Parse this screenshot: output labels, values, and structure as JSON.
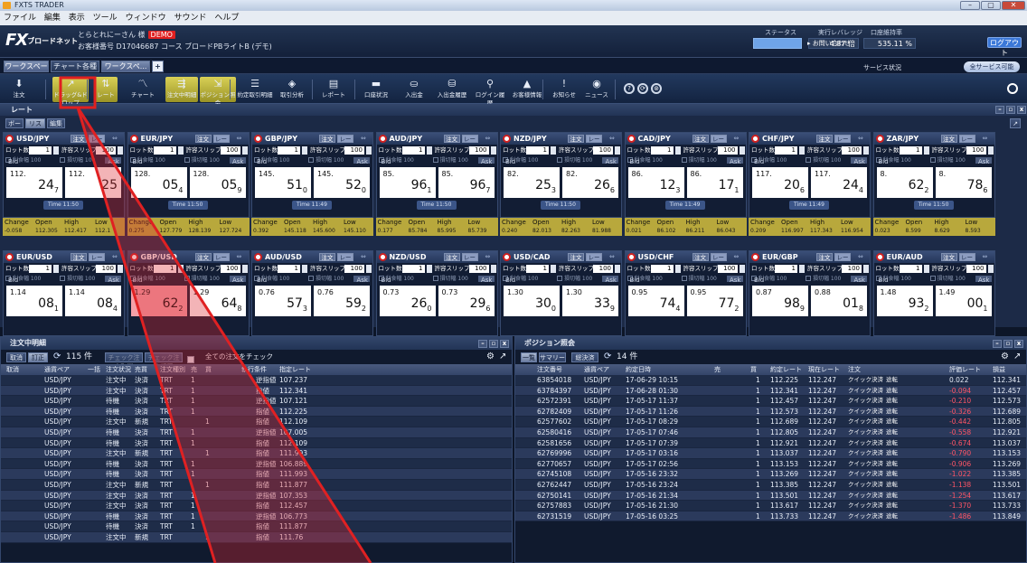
{
  "window": {
    "title": "FXTS TRADER",
    "buttons": [
      "–",
      "▢",
      "✕"
    ]
  },
  "menu": [
    "ファイル",
    "編集",
    "表示",
    "ツール",
    "ウィンドウ",
    "サウンド",
    "ヘルプ"
  ],
  "header": {
    "logo": "FX",
    "logo_sub": "ブロードネット",
    "user_name": "とらとれにーさん 様",
    "demo_badge": "DEMO",
    "account_line": "お客様番号 D17046687  コース ブロードPBライトB (デモ)",
    "status_label": "ステータス",
    "leverage_label": "実行レバレッジ",
    "leverage_value": "4.87 倍",
    "margin_label": "口座維持率",
    "margin_value": "535.11 %",
    "contact_label": "▸ お問い合わせ",
    "logout_label": "ログアウト"
  },
  "workspace": {
    "tabs": [
      {
        "label": "ワークスペース",
        "active": true
      },
      {
        "label": "チャート各種",
        "active": false
      },
      {
        "label": "ワークスペ... ▾",
        "active": true
      }
    ],
    "add_label": "+",
    "service_status_label": "サービス状況",
    "service_badge": "全サービス可能"
  },
  "toolbar": {
    "buttons": [
      {
        "label": "注文",
        "icon": "arrow-down-icon",
        "glyph": "⬇"
      },
      {
        "label": "ドラッグ&ドロップ",
        "icon": "drag-icon",
        "glyph": "↗"
      },
      {
        "label": "レート",
        "icon": "rate-icon",
        "glyph": "⇅"
      },
      {
        "label": "チャート",
        "icon": "chart-icon",
        "glyph": "〽"
      },
      {
        "label": "注文中明細",
        "icon": "order-list-icon",
        "glyph": "⇶"
      },
      {
        "label": "ポジション照会",
        "icon": "position-icon",
        "glyph": "⇲"
      },
      {
        "label": "約定取引明細",
        "icon": "trade-detail-icon",
        "glyph": "☰"
      },
      {
        "label": "取引分析",
        "icon": "analysis-icon",
        "glyph": "◈"
      },
      {
        "label": "レポート",
        "icon": "report-icon",
        "glyph": "▤"
      },
      {
        "label": "口座状況",
        "icon": "account-icon",
        "glyph": "▬"
      },
      {
        "label": "入出金",
        "icon": "deposit-icon",
        "glyph": "⛀"
      },
      {
        "label": "入出金履歴",
        "icon": "history-icon",
        "glyph": "⛁"
      },
      {
        "label": "ログイン履歴",
        "icon": "login-icon",
        "glyph": "⚲"
      },
      {
        "label": "お客様情報",
        "icon": "user-icon",
        "glyph": "▲"
      },
      {
        "label": "お知らせ",
        "icon": "notice-icon",
        "glyph": "!"
      },
      {
        "label": "ニュース",
        "icon": "news-icon",
        "glyph": "◉"
      }
    ],
    "circle_buttons": [
      "?",
      "⟳",
      "⊚"
    ]
  },
  "rate_panel": {
    "title": "レート",
    "view_buttons": [
      "ボード",
      "リスト",
      "編集"
    ],
    "lot_label": "ロット数",
    "slip_label": "許容スリップ",
    "profit_label": "利食幅",
    "loss_label": "損切幅",
    "order_label": "注文",
    "rate_label": "レート",
    "bid_label": "Bid",
    "ask_label": "Ask",
    "change_headers": [
      "Change",
      "Open",
      "High",
      "Low"
    ],
    "pairs_row1": [
      {
        "pair": "USD/JPY",
        "bid_head": "112.",
        "bid_tail": "24",
        "bid_sub": "7",
        "ask_head": "112.",
        "ask_tail": "25",
        "ask_sub": "",
        "time": "Time 11:50",
        "change": "-0.058",
        "open": "112.305",
        "high": "112.417",
        "low": "112.1"
      },
      {
        "pair": "EUR/JPY",
        "bid_head": "128.",
        "bid_tail": "05",
        "bid_sub": "4",
        "ask_head": "128.",
        "ask_tail": "05",
        "ask_sub": "9",
        "time": "Time 11:50",
        "change": "0.275",
        "open": "127.779",
        "high": "128.139",
        "low": "127.724"
      },
      {
        "pair": "GBP/JPY",
        "bid_head": "145.",
        "bid_tail": "51",
        "bid_sub": "0",
        "ask_head": "145.",
        "ask_tail": "52",
        "ask_sub": "0",
        "time": "Time 11:49",
        "change": "0.392",
        "open": "145.118",
        "high": "145.600",
        "low": "145.110"
      },
      {
        "pair": "AUD/JPY",
        "bid_head": "85.",
        "bid_tail": "96",
        "bid_sub": "1",
        "ask_head": "85.",
        "ask_tail": "96",
        "ask_sub": "7",
        "time": "Time 11:50",
        "change": "0.177",
        "open": "85.784",
        "high": "85.995",
        "low": "85.739"
      },
      {
        "pair": "NZD/JPY",
        "bid_head": "82.",
        "bid_tail": "25",
        "bid_sub": "3",
        "ask_head": "82.",
        "ask_tail": "26",
        "ask_sub": "6",
        "time": "Time 11:50",
        "change": "0.240",
        "open": "82.013",
        "high": "82.263",
        "low": "81.988"
      },
      {
        "pair": "CAD/JPY",
        "bid_head": "86.",
        "bid_tail": "12",
        "bid_sub": "3",
        "ask_head": "86.",
        "ask_tail": "17",
        "ask_sub": "1",
        "time": "Time 11:49",
        "change": "0.021",
        "open": "86.102",
        "high": "86.211",
        "low": "86.043"
      },
      {
        "pair": "CHF/JPY",
        "bid_head": "117.",
        "bid_tail": "20",
        "bid_sub": "6",
        "ask_head": "117.",
        "ask_tail": "24",
        "ask_sub": "4",
        "time": "Time 11:49",
        "change": "0.209",
        "open": "116.997",
        "high": "117.343",
        "low": "116.954"
      },
      {
        "pair": "ZAR/JPY",
        "bid_head": "8.",
        "bid_tail": "62",
        "bid_sub": "2",
        "ask_head": "8.",
        "ask_tail": "78",
        "ask_sub": "6",
        "time": "Time 11:50",
        "change": "0.023",
        "open": "8.599",
        "high": "8.629",
        "low": "8.593"
      }
    ],
    "pairs_row2": [
      {
        "pair": "EUR/USD",
        "bid_head": "1.14",
        "bid_tail": "08",
        "bid_sub": "1",
        "ask_head": "1.14",
        "ask_tail": "08",
        "ask_sub": "4"
      },
      {
        "pair": "GBP/USD",
        "bid_head": "1.29",
        "bid_tail": "62",
        "bid_sub": "2",
        "ask_head": "1.29",
        "ask_tail": "64",
        "ask_sub": "8"
      },
      {
        "pair": "AUD/USD",
        "bid_head": "0.76",
        "bid_tail": "57",
        "bid_sub": "3",
        "ask_head": "0.76",
        "ask_tail": "59",
        "ask_sub": "2"
      },
      {
        "pair": "NZD/USD",
        "bid_head": "0.73",
        "bid_tail": "26",
        "bid_sub": "0",
        "ask_head": "0.73",
        "ask_tail": "29",
        "ask_sub": "6"
      },
      {
        "pair": "USD/CAD",
        "bid_head": "1.30",
        "bid_tail": "30",
        "bid_sub": "0",
        "ask_head": "1.30",
        "ask_tail": "33",
        "ask_sub": "9"
      },
      {
        "pair": "USD/CHF",
        "bid_head": "0.95",
        "bid_tail": "74",
        "bid_sub": "4",
        "ask_head": "0.95",
        "ask_tail": "77",
        "ask_sub": "2"
      },
      {
        "pair": "EUR/GBP",
        "bid_head": "0.87",
        "bid_tail": "98",
        "bid_sub": "9",
        "ask_head": "0.88",
        "ask_tail": "01",
        "ask_sub": "8"
      },
      {
        "pair": "EUR/AUD",
        "bid_head": "1.48",
        "bid_tail": "93",
        "bid_sub": "2",
        "ask_head": "1.49",
        "ask_tail": "00",
        "ask_sub": "1"
      }
    ],
    "lot_value": "1",
    "slip_value": "100",
    "tp_value": "100",
    "sl_value": "100"
  },
  "orders_panel": {
    "title": "注文中明細",
    "tools": [
      "取消",
      "訂正"
    ],
    "count": "115 件",
    "check_buttons": [
      "チェック注文取消",
      "チェック注文訂正"
    ],
    "all_check_label": "全ての注文をチェック",
    "headers": [
      "取消",
      "通貨ペア",
      "一括",
      "注文状況",
      "売買",
      "注文種別",
      "売",
      "買",
      "執行条件",
      "指定レート"
    ],
    "rows": [
      {
        "pair": "USD/JPY",
        "status": "注文中",
        "kind": "決済",
        "type": "TRT",
        "sell": "1",
        "buy": "",
        "cond": "逆指値",
        "rate": "107.237"
      },
      {
        "pair": "USD/JPY",
        "status": "注文中",
        "kind": "決済",
        "type": "TRT",
        "sell": "1",
        "buy": "",
        "cond": "指値",
        "rate": "112.341"
      },
      {
        "pair": "USD/JPY",
        "status": "待機",
        "kind": "決済",
        "type": "TRT",
        "sell": "1",
        "buy": "",
        "cond": "逆指値",
        "rate": "107.121"
      },
      {
        "pair": "USD/JPY",
        "status": "待機",
        "kind": "決済",
        "type": "TRT",
        "sell": "1",
        "buy": "",
        "cond": "指値",
        "rate": "112.225"
      },
      {
        "pair": "USD/JPY",
        "status": "注文中",
        "kind": "新規",
        "type": "TRT",
        "sell": "",
        "buy": "1",
        "cond": "指値",
        "rate": "112.109"
      },
      {
        "pair": "USD/JPY",
        "status": "待機",
        "kind": "決済",
        "type": "TRT",
        "sell": "1",
        "buy": "",
        "cond": "逆指値",
        "rate": "107.005"
      },
      {
        "pair": "USD/JPY",
        "status": "待機",
        "kind": "決済",
        "type": "TRT",
        "sell": "1",
        "buy": "",
        "cond": "指値",
        "rate": "112.109"
      },
      {
        "pair": "USD/JPY",
        "status": "注文中",
        "kind": "新規",
        "type": "TRT",
        "sell": "",
        "buy": "1",
        "cond": "指値",
        "rate": "111.993"
      },
      {
        "pair": "USD/JPY",
        "status": "待機",
        "kind": "決済",
        "type": "TRT",
        "sell": "1",
        "buy": "",
        "cond": "逆指値",
        "rate": "106.889"
      },
      {
        "pair": "USD/JPY",
        "status": "待機",
        "kind": "決済",
        "type": "TRT",
        "sell": "1",
        "buy": "",
        "cond": "指値",
        "rate": "111.993"
      },
      {
        "pair": "USD/JPY",
        "status": "注文中",
        "kind": "新規",
        "type": "TRT",
        "sell": "",
        "buy": "1",
        "cond": "指値",
        "rate": "111.877"
      },
      {
        "pair": "USD/JPY",
        "status": "注文中",
        "kind": "決済",
        "type": "TRT",
        "sell": "1",
        "buy": "",
        "cond": "逆指値",
        "rate": "107.353"
      },
      {
        "pair": "USD/JPY",
        "status": "注文中",
        "kind": "決済",
        "type": "TRT",
        "sell": "1",
        "buy": "",
        "cond": "指値",
        "rate": "112.457"
      },
      {
        "pair": "USD/JPY",
        "status": "待機",
        "kind": "決済",
        "type": "TRT",
        "sell": "1",
        "buy": "",
        "cond": "逆指値",
        "rate": "106.773"
      },
      {
        "pair": "USD/JPY",
        "status": "待機",
        "kind": "決済",
        "type": "TRT",
        "sell": "1",
        "buy": "",
        "cond": "指値",
        "rate": "111.877"
      },
      {
        "pair": "USD/JPY",
        "status": "注文中",
        "kind": "新規",
        "type": "TRT",
        "sell": "",
        "buy": "1",
        "cond": "指値",
        "rate": "111.76"
      }
    ]
  },
  "positions_panel": {
    "title": "ポジション照会",
    "tools": [
      "一覧",
      "サマリー",
      "総決済"
    ],
    "count": "14 件",
    "headers": [
      "注文番号",
      "通貨ペア",
      "約定日時",
      "売",
      "買",
      "約定レート",
      "現在レート",
      "注文",
      "",
      "評価レート",
      "損益"
    ],
    "quick_label": "クイック決済",
    "reverse_label": "途転",
    "rows": [
      {
        "id": "63854018",
        "pair": "USD/JPY",
        "date": "17-06-29 10:15",
        "buy": "1",
        "rate": "112.225",
        "now": "112.247",
        "pl": "0.022",
        "pos": true,
        "eval": "112.341"
      },
      {
        "id": "63784397",
        "pair": "USD/JPY",
        "date": "17-06-28 01:30",
        "buy": "1",
        "rate": "112.341",
        "now": "112.247",
        "pl": "-0.094",
        "pos": false,
        "eval": "112.457"
      },
      {
        "id": "62572391",
        "pair": "USD/JPY",
        "date": "17-05-17 11:37",
        "buy": "1",
        "rate": "112.457",
        "now": "112.247",
        "pl": "-0.210",
        "pos": false,
        "eval": "112.573"
      },
      {
        "id": "62782409",
        "pair": "USD/JPY",
        "date": "17-05-17 11:26",
        "buy": "1",
        "rate": "112.573",
        "now": "112.247",
        "pl": "-0.326",
        "pos": false,
        "eval": "112.689"
      },
      {
        "id": "62577602",
        "pair": "USD/JPY",
        "date": "17-05-17 08:29",
        "buy": "1",
        "rate": "112.689",
        "now": "112.247",
        "pl": "-0.442",
        "pos": false,
        "eval": "112.805"
      },
      {
        "id": "62580416",
        "pair": "USD/JPY",
        "date": "17-05-17 07:46",
        "buy": "1",
        "rate": "112.805",
        "now": "112.247",
        "pl": "-0.558",
        "pos": false,
        "eval": "112.921"
      },
      {
        "id": "62581656",
        "pair": "USD/JPY",
        "date": "17-05-17 07:39",
        "buy": "1",
        "rate": "112.921",
        "now": "112.247",
        "pl": "-0.674",
        "pos": false,
        "eval": "113.037"
      },
      {
        "id": "62769996",
        "pair": "USD/JPY",
        "date": "17-05-17 03:16",
        "buy": "1",
        "rate": "113.037",
        "now": "112.247",
        "pl": "-0.790",
        "pos": false,
        "eval": "113.153"
      },
      {
        "id": "62770657",
        "pair": "USD/JPY",
        "date": "17-05-17 02:56",
        "buy": "1",
        "rate": "113.153",
        "now": "112.247",
        "pl": "-0.906",
        "pos": false,
        "eval": "113.269"
      },
      {
        "id": "62745108",
        "pair": "USD/JPY",
        "date": "17-05-16 23:32",
        "buy": "1",
        "rate": "113.269",
        "now": "112.247",
        "pl": "-1.022",
        "pos": false,
        "eval": "113.385"
      },
      {
        "id": "62762447",
        "pair": "USD/JPY",
        "date": "17-05-16 23:24",
        "buy": "1",
        "rate": "113.385",
        "now": "112.247",
        "pl": "-1.138",
        "pos": false,
        "eval": "113.501"
      },
      {
        "id": "62750141",
        "pair": "USD/JPY",
        "date": "17-05-16 21:34",
        "buy": "1",
        "rate": "113.501",
        "now": "112.247",
        "pl": "-1.254",
        "pos": false,
        "eval": "113.617"
      },
      {
        "id": "62757883",
        "pair": "USD/JPY",
        "date": "17-05-16 21:30",
        "buy": "1",
        "rate": "113.617",
        "now": "112.247",
        "pl": "-1.370",
        "pos": false,
        "eval": "113.733"
      },
      {
        "id": "62731519",
        "pair": "USD/JPY",
        "date": "17-05-16 03:25",
        "buy": "1",
        "rate": "113.733",
        "now": "112.247",
        "pl": "-1.486",
        "pos": false,
        "eval": "113.849"
      }
    ]
  },
  "colors": {
    "highlight": "#e02020",
    "accent": "#3b78d8",
    "quote_bar": "#b8a83c"
  }
}
